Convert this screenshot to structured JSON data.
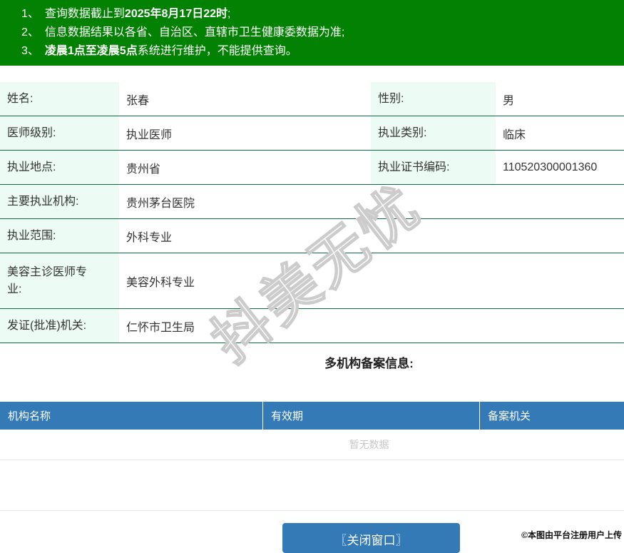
{
  "banner": {
    "notices": [
      {
        "num": "1、",
        "segments": [
          {
            "text": "查询数据截止到",
            "bold": false
          },
          {
            "text": "2025年8月17日22时",
            "bold": true
          },
          {
            "text": ";",
            "bold": false
          }
        ]
      },
      {
        "num": "2、",
        "segments": [
          {
            "text": "信息数据结果以各省、自治区、直辖市卫生健康委数据为准;",
            "bold": false
          }
        ]
      },
      {
        "num": "3、",
        "segments": [
          {
            "text": "凌晨1点至凌晨5点",
            "bold": true
          },
          {
            "text": "系统进行维护，不能提供查询。",
            "bold": false
          }
        ]
      }
    ]
  },
  "profile": {
    "rows": [
      {
        "left": {
          "label": "姓名:",
          "value": "张春"
        },
        "right": {
          "label": "性别:",
          "value": "男"
        }
      },
      {
        "left": {
          "label": "医师级别:",
          "value": "执业医师"
        },
        "right": {
          "label": "执业类别:",
          "value": "临床"
        }
      },
      {
        "left": {
          "label": "执业地点:",
          "value": "贵州省"
        },
        "right": {
          "label": "执业证书编码:",
          "value": "110520300001360"
        }
      },
      {
        "label": "主要执业机构:",
        "value": "贵州茅台医院"
      },
      {
        "label": "执业范围:",
        "value": "外科专业"
      },
      {
        "label": "美容主诊医师专业:",
        "value": "美容外科专业"
      },
      {
        "label": "发证(批准)机关:",
        "value": "仁怀市卫生局"
      }
    ]
  },
  "filing": {
    "title": "多机构备案信息:",
    "columns": [
      "机构名称",
      "有效期",
      "备案机关"
    ],
    "empty_text": "暂无数据"
  },
  "footer": {
    "close_button": "〖关闭窗口〗",
    "copyright": "©本图由平台注册用户上传"
  },
  "watermark_text": "抖美无忧",
  "colors": {
    "banner_green": "#028102",
    "row_border_green": "#0f6b40",
    "label_mint": "#ecfbf4",
    "table_header_blue": "#337ab7",
    "button_blue": "#337ab7",
    "empty_text_gray": "#c7c7c7"
  }
}
